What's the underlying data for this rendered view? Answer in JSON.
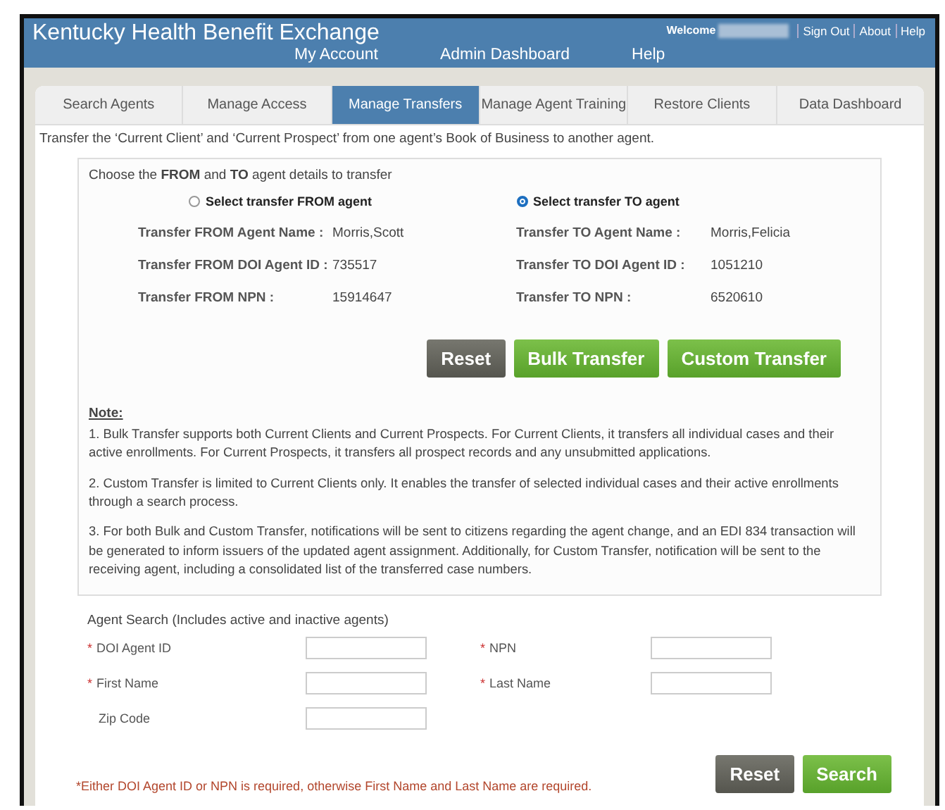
{
  "header": {
    "title": "Kentucky Health Benefit Exchange",
    "nav": [
      "My Account",
      "Admin Dashboard",
      "Help"
    ],
    "welcome": "Welcome",
    "links": [
      "Sign Out",
      "About",
      "Help"
    ]
  },
  "tabs": [
    {
      "label": "Search Agents",
      "selected": false
    },
    {
      "label": "Manage Access",
      "selected": false
    },
    {
      "label": "Manage Transfers",
      "selected": true
    },
    {
      "label": "Manage Agent Training",
      "selected": false
    },
    {
      "label": "Restore Clients",
      "selected": false
    },
    {
      "label": "Data Dashboard",
      "selected": false
    }
  ],
  "intro": "Transfer the ‘Current Client’ and ‘Current Prospect’ from one agent’s Book of Business to another agent.",
  "transfer": {
    "heading": "Choose the **FROM** and **TO** agent details to transfer",
    "sides": [
      {
        "radio": {
          "label": "Select transfer FROM agent",
          "selected": false
        },
        "fields": [
          {
            "label": "Transfer FROM Agent Name :",
            "value": "Morris,Scott"
          },
          {
            "label": "Transfer FROM DOI Agent ID :",
            "value": "735517"
          },
          {
            "label": "Transfer FROM NPN :",
            "value": "15914647"
          }
        ]
      },
      {
        "radio": {
          "label": "Select transfer TO agent",
          "selected": true
        },
        "fields": [
          {
            "label": "Transfer TO Agent Name :",
            "value": "Morris,Felicia"
          },
          {
            "label": "Transfer TO DOI Agent ID :",
            "value": "1051210"
          },
          {
            "label": "Transfer TO NPN :",
            "value": "6520610"
          }
        ]
      }
    ],
    "buttons": [
      {
        "label": "Reset",
        "kind": "secondary"
      },
      {
        "label": "Bulk Transfer",
        "kind": "primary"
      },
      {
        "label": "Custom Transfer",
        "kind": "primary"
      }
    ]
  },
  "note": {
    "title": "Note:",
    "items": [
      "1. Bulk Transfer supports both Current Clients and Current Prospects. For Current Clients, it transfers all individual cases and their active enrollments. For Current Prospects, it transfers all prospect records and any unsubmitted applications.",
      "2. Custom Transfer is limited to Current Clients only. It enables the transfer of selected individual cases and their active enrollments through a search process.",
      "3. For both Bulk and Custom Transfer, notifications will be sent to citizens regarding the agent change, and an EDI 834 transaction will be generated to inform issuers of the updated agent assignment. Additionally, for Custom Transfer, notification will be sent to the receiving agent, including a consolidated list of the transferred case numbers."
    ]
  },
  "search": {
    "title": "Agent Search (Includes active and inactive agents)",
    "fields": [
      {
        "label": "DOI Agent ID",
        "required": true
      },
      {
        "label": "NPN",
        "required": true
      },
      {
        "label": "First Name",
        "required": true
      },
      {
        "label": "Last Name",
        "required": true
      },
      {
        "label": "Zip Code",
        "required": false
      }
    ],
    "required_mark": "*",
    "hint": "*Either DOI Agent ID or NPN is required, otherwise First Name and Last Name are required.",
    "buttons": [
      {
        "label": "Reset",
        "kind": "secondary"
      },
      {
        "label": "Search",
        "kind": "primary"
      }
    ]
  }
}
